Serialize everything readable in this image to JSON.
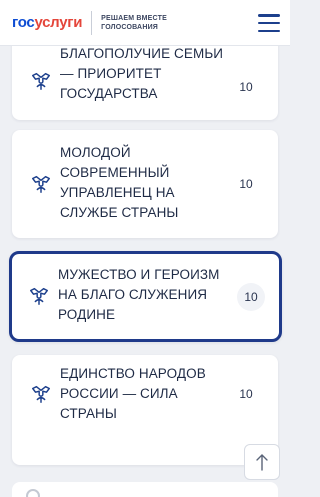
{
  "header": {
    "logo_part1": "гос",
    "logo_part2": "услуги",
    "tagline": "РЕШАЕМ ВМЕСТЕ ГОЛОСОВАНИЯ",
    "menu_icon": "hamburger-menu-icon"
  },
  "cards": [
    {
      "title": "БЛАГОПОЛУЧИЕ СЕМЬИ — ПРИОРИТЕТ ГОСУДАРСТВА",
      "count": "10",
      "selected": false
    },
    {
      "title": "МОЛОДОЙ СОВРЕМЕННЫЙ УПРАВЛЕНЕЦ НА СЛУЖБЕ СТРАНЫ",
      "count": "10",
      "selected": false
    },
    {
      "title": "МУЖЕСТВО И ГЕРОИЗМ НА БЛАГО СЛУЖЕНИЯ РОДИНЕ",
      "count": "10",
      "selected": true
    },
    {
      "title": "ЕДИНСТВО НАРОДОВ РОССИИ — СИЛА СТРАНЫ",
      "count": "10",
      "selected": false
    }
  ],
  "card_icon": "emblem-icon",
  "scroll_top_icon": "arrow-up-icon",
  "colors": {
    "brand_blue": "#0d4cd3",
    "brand_red": "#e4453a",
    "selected_border": "#1f3a8a",
    "background": "#eef0f4"
  }
}
